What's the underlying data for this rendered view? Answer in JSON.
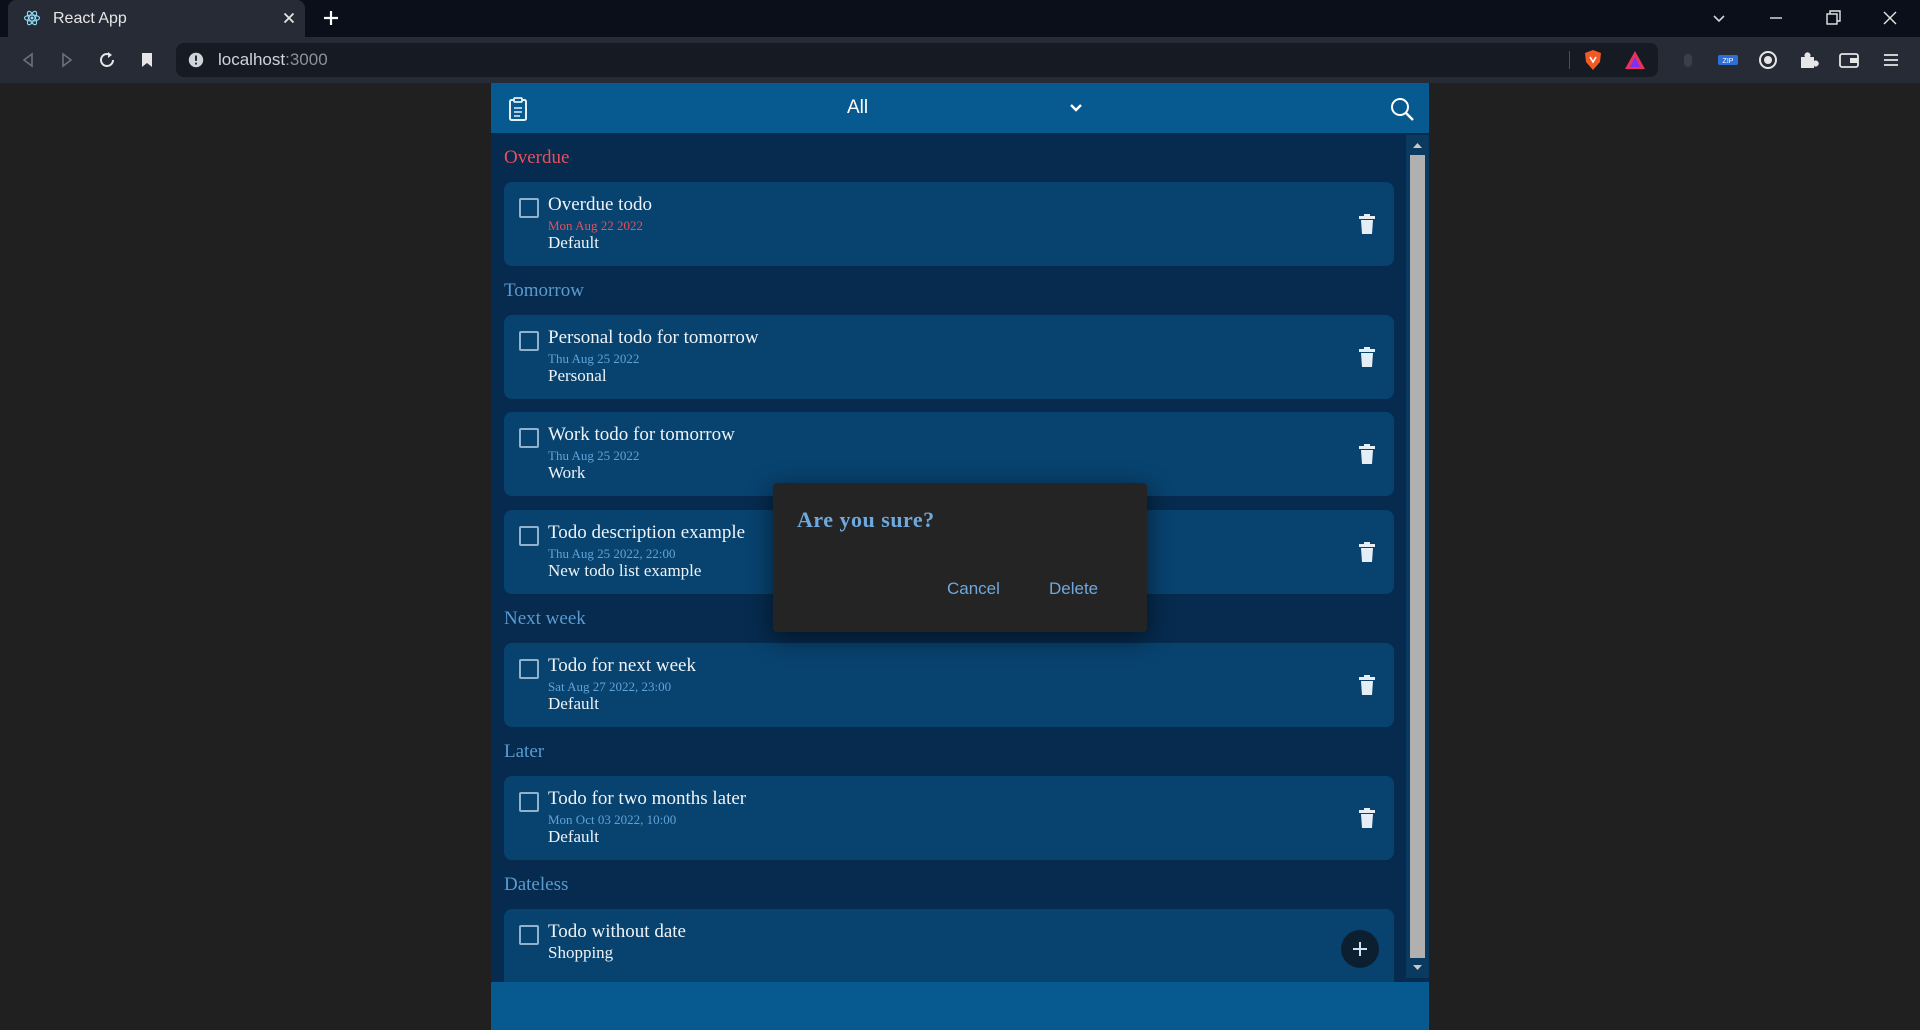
{
  "browser": {
    "tab_title": "React App",
    "url_host": "localhost",
    "url_port": ":3000"
  },
  "header": {
    "filter_value": "All"
  },
  "sections": [
    {
      "title": "Overdue",
      "todos": [
        {
          "title": "Overdue todo",
          "date": "Mon Aug 22 2022",
          "list": "Default"
        }
      ]
    },
    {
      "title": "Tomorrow",
      "todos": [
        {
          "title": "Personal todo for tomorrow",
          "date": "Thu Aug 25 2022",
          "list": "Personal"
        },
        {
          "title": "Work todo for tomorrow",
          "date": "Thu Aug 25 2022",
          "list": "Work"
        },
        {
          "title": "Todo description example",
          "date": "Thu Aug 25 2022, 22:00",
          "list": "New todo list example"
        }
      ]
    },
    {
      "title": "Next week",
      "todos": [
        {
          "title": "Todo for next week",
          "date": "Sat Aug 27 2022, 23:00",
          "list": "Default"
        }
      ]
    },
    {
      "title": "Later",
      "todos": [
        {
          "title": "Todo for two months later",
          "date": "Mon Oct 03 2022, 10:00",
          "list": "Default"
        }
      ]
    },
    {
      "title": "Dateless",
      "todos": [
        {
          "title": "Todo without date",
          "list": "Shopping"
        }
      ]
    }
  ],
  "dialog": {
    "title": "Are you sure?",
    "cancel_label": "Cancel",
    "delete_label": "Delete"
  },
  "colors": {
    "overdue": "#e8505b",
    "accent": "#6fa8dc",
    "header": "#075a8f",
    "card": "#08426f",
    "background": "#062b4e"
  }
}
